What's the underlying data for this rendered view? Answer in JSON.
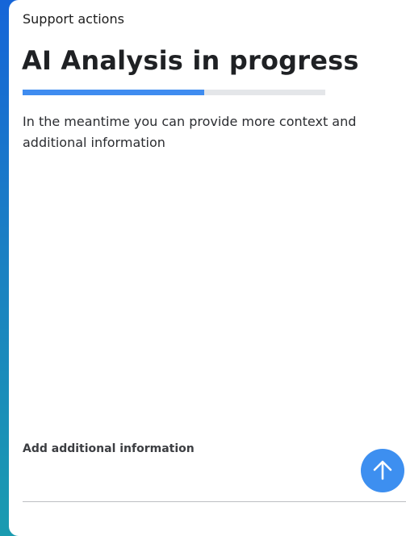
{
  "header": {
    "label": "Support actions"
  },
  "main": {
    "title": "AI Analysis in progress",
    "progress": 0.6,
    "subtitle": "In the meantime you can provide more context and additional information"
  },
  "input": {
    "label": "Add additional information",
    "value": "",
    "placeholder": ""
  },
  "send_button": {
    "icon": "arrow-up-icon"
  },
  "colors": {
    "progress_fill": "#3f8cf0",
    "progress_track": "#e4e6e9",
    "send_button": "#3d8ff0",
    "background_gradient_top": "#1565d8",
    "background_gradient_bottom": "#1a9bb0"
  }
}
